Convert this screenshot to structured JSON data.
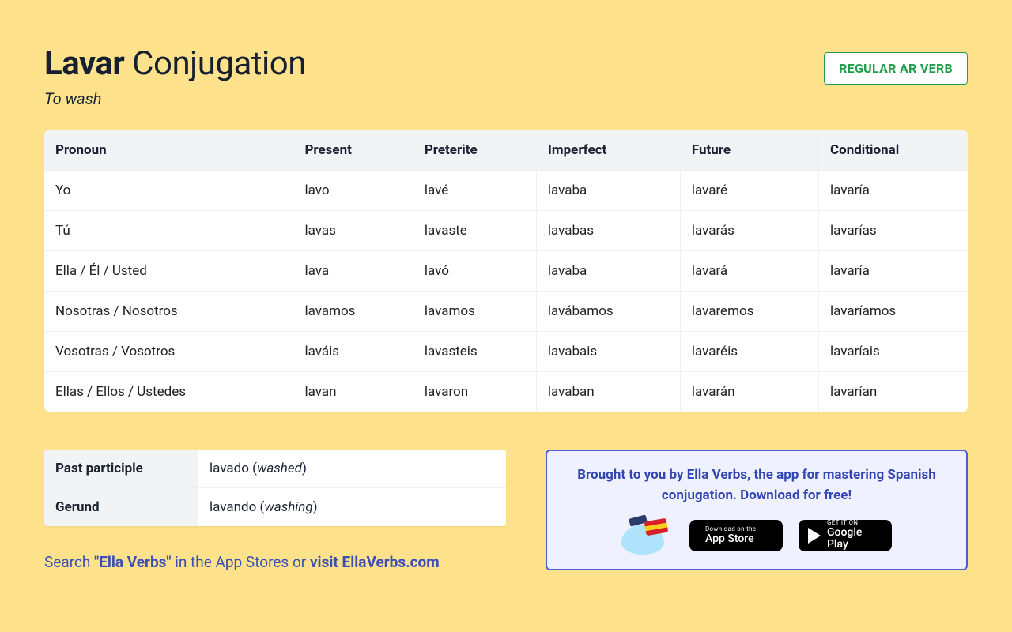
{
  "header": {
    "verb": "Lavar",
    "title_suffix": "Conjugation",
    "translation": "To wash",
    "badge": "REGULAR AR VERB"
  },
  "table": {
    "columns": [
      "Pronoun",
      "Present",
      "Preterite",
      "Imperfect",
      "Future",
      "Conditional"
    ],
    "rows": [
      {
        "pronoun": "Yo",
        "present": "lavo",
        "preterite": "lavé",
        "imperfect": "lavaba",
        "future": "lavaré",
        "conditional": "lavaría"
      },
      {
        "pronoun": "Tú",
        "present": "lavas",
        "preterite": "lavaste",
        "imperfect": "lavabas",
        "future": "lavarás",
        "conditional": "lavarías"
      },
      {
        "pronoun": "Ella / Él / Usted",
        "present": "lava",
        "preterite": "lavó",
        "imperfect": "lavaba",
        "future": "lavará",
        "conditional": "lavaría"
      },
      {
        "pronoun": "Nosotras / Nosotros",
        "present": "lavamos",
        "preterite": "lavamos",
        "imperfect": "lavábamos",
        "future": "lavaremos",
        "conditional": "lavaríamos"
      },
      {
        "pronoun": "Vosotras / Vosotros",
        "present": "laváis",
        "preterite": "lavasteis",
        "imperfect": "lavabais",
        "future": "lavaréis",
        "conditional": "lavaríais"
      },
      {
        "pronoun": "Ellas / Ellos / Ustedes",
        "present": "lavan",
        "preterite": "lavaron",
        "imperfect": "lavaban",
        "future": "lavarán",
        "conditional": "lavarían"
      }
    ]
  },
  "forms": [
    {
      "label": "Past participle",
      "value": "lavado",
      "gloss": "washed"
    },
    {
      "label": "Gerund",
      "value": "lavando",
      "gloss": "washing"
    }
  ],
  "search_line": {
    "prefix": "Search ",
    "quoted": "\"Ella Verbs\"",
    "middle": " in the App Stores or ",
    "link": "visit EllaVerbs.com"
  },
  "promo": {
    "text": "Brought to you by Ella Verbs, the app for mastering Spanish conjugation. Download for free!",
    "apple": {
      "small": "Download on the",
      "big": "App Store"
    },
    "google": {
      "small": "GET IT ON",
      "big": "Google Play"
    }
  }
}
